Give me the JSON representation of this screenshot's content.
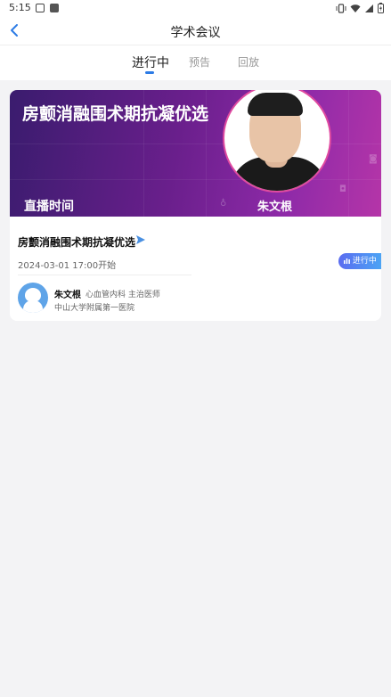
{
  "status_bar": {
    "time": "5:15"
  },
  "header": {
    "title": "学术会议"
  },
  "tabs": [
    {
      "label": "进行中"
    },
    {
      "label": "预告"
    },
    {
      "label": "回放"
    }
  ],
  "card": {
    "banner": {
      "title": "房颤消融围术期抗凝优选",
      "live_label": "直播时间",
      "speaker": "朱文根"
    },
    "title": "房颤消融围术期抗凝优选",
    "start_time": "2024-03-01 17:00开始",
    "status": "进行中",
    "speaker": {
      "name": "朱文根",
      "department": "心血管内科 主治医师",
      "hospital": "中山大学附属第一医院"
    }
  },
  "colors": {
    "accent": "#2c7be5",
    "badge_start": "#5b6cf0",
    "badge_end": "#4aa8f5",
    "banner_purple": "#6a1f8c"
  }
}
